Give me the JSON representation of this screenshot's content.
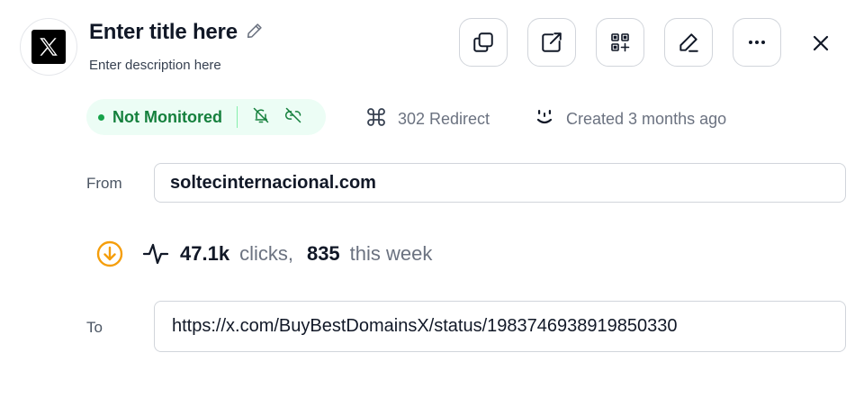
{
  "header": {
    "title": "Enter title here",
    "description": "Enter description here",
    "logo_icon": "x-logo-icon"
  },
  "toolbar": {
    "buttons": [
      {
        "name": "copy-button",
        "icon": "copy-icon"
      },
      {
        "name": "open-external-button",
        "icon": "external-link-icon"
      },
      {
        "name": "qr-code-button",
        "icon": "qr-code-icon"
      },
      {
        "name": "edit-button",
        "icon": "pencil-icon"
      },
      {
        "name": "more-options-button",
        "icon": "ellipsis-icon"
      }
    ],
    "close_icon": "close-icon"
  },
  "status": {
    "label": "Not Monitored",
    "color": "#15803d",
    "background": "#ecfdf5",
    "icons": [
      "bell-off-icon",
      "link-off-icon"
    ]
  },
  "meta": {
    "redirect": "302 Redirect",
    "created": "Created 3 months ago"
  },
  "from": {
    "label": "From",
    "value": "soltecinternacional.com"
  },
  "stats": {
    "clicks": "47.1k",
    "clicks_label": "clicks,",
    "week": "835",
    "week_label": "this week",
    "accent": "#f59e0b"
  },
  "to": {
    "label": "To",
    "value": "https://x.com/BuyBestDomainsX/status/1983746938919850330"
  }
}
